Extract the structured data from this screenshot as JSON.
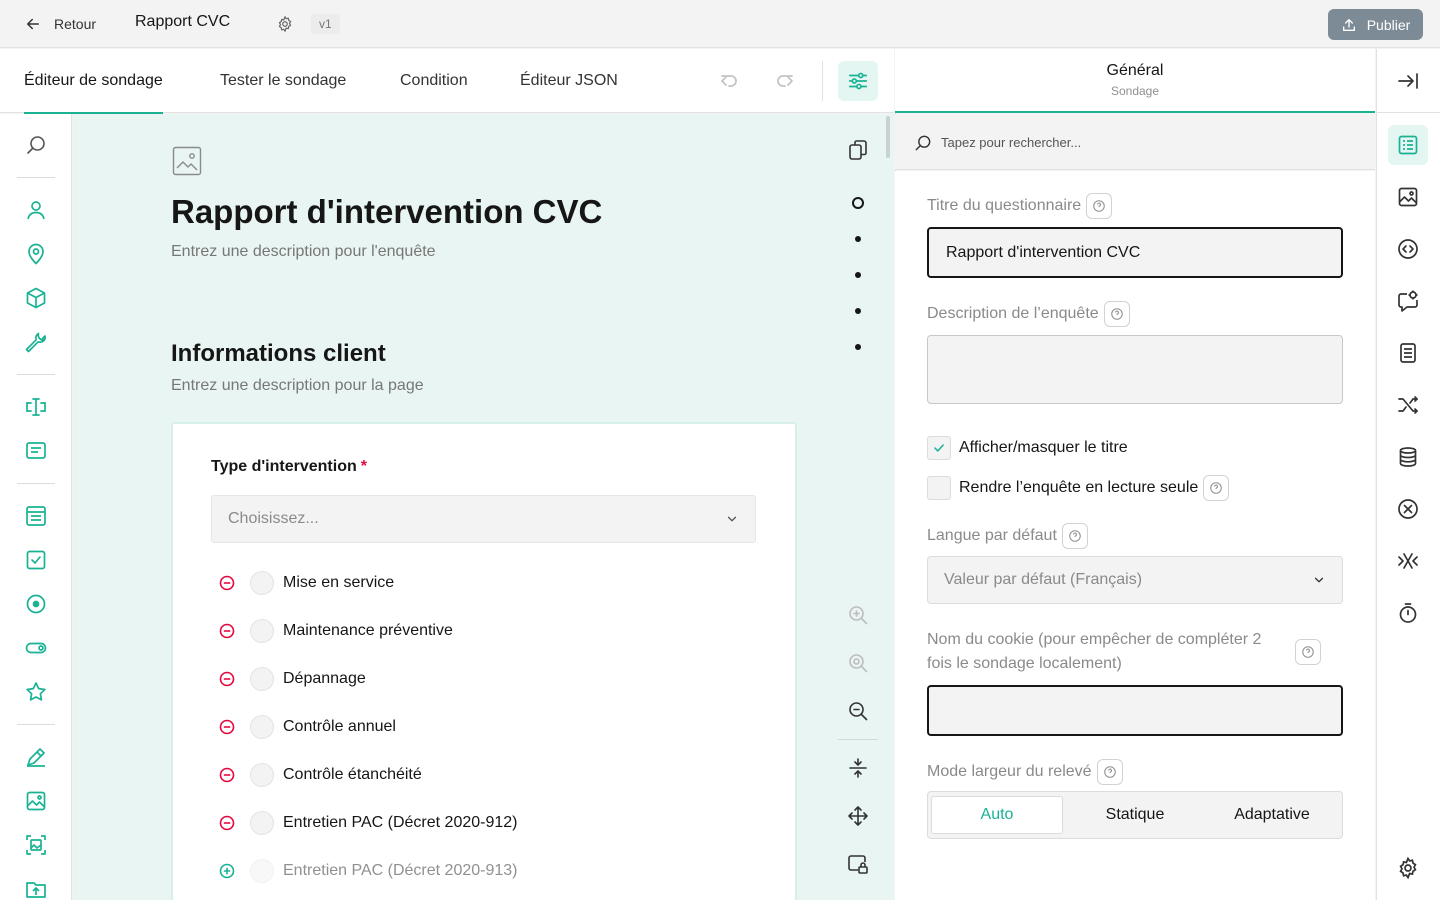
{
  "header": {
    "back_label": "Retour",
    "doc_title": "Rapport CVC",
    "version": "v1",
    "publish_label": "Publier"
  },
  "tabs": [
    {
      "label": "Éditeur de sondage",
      "active": true
    },
    {
      "label": "Tester le sondage",
      "active": false
    },
    {
      "label": "Condition",
      "active": false
    },
    {
      "label": "Éditeur JSON",
      "active": false
    }
  ],
  "survey": {
    "title": "Rapport d'intervention CVC",
    "description_placeholder": "Entrez une description pour l'enquête",
    "page": {
      "title": "Informations client",
      "description_placeholder": "Entrez une description pour la page"
    },
    "question": {
      "title": "Type d'intervention",
      "required_marker": "*",
      "select_placeholder": "Choisissez...",
      "choices": [
        "Mise en service",
        "Maintenance préventive",
        "Dépannage",
        "Contrôle annuel",
        "Contrôle étanchéité",
        "Entretien PAC (Décret 2020-912)"
      ],
      "new_choice": "Entretien PAC (Décret 2020-913)"
    }
  },
  "property_grid": {
    "title": "Général",
    "subtitle": "Sondage",
    "search_placeholder": "Tapez pour rechercher...",
    "survey_title_label": "Titre du questionnaire",
    "survey_title_value": "Rapport d'intervention CVC",
    "description_label": "Description de l’enquête",
    "show_title_label": "Afficher/masquer le titre",
    "show_title_checked": true,
    "readonly_label": "Rendre l’enquête en lecture seule",
    "readonly_checked": false,
    "language_label": "Langue par défaut",
    "language_value": "Valeur par défaut (Français)",
    "cookie_label": "Nom du cookie (pour empêcher de compléter 2 fois le sondage localement)",
    "width_mode_label": "Mode largeur du relevé",
    "width_modes": [
      "Auto",
      "Statique",
      "Adaptative"
    ],
    "width_mode_selected": "Auto"
  },
  "colors": {
    "accent": "#19b394",
    "accent_light": "#e4f6f2",
    "canvas_bg": "#e8f5f2",
    "remove_red": "#e50a3e",
    "publish_bg": "#7d8b96"
  },
  "icons": {
    "toolbox": [
      "search-icon",
      "user-icon",
      "map-pin-icon",
      "cube-icon",
      "wrench-icon",
      "text-cursor-icon",
      "comment-icon",
      "dropdown-list-icon",
      "checkbox-icon",
      "radio-icon",
      "toggle-icon",
      "star-icon",
      "signature-icon",
      "image-icon",
      "image-picker-icon",
      "file-upload-icon"
    ],
    "right_rail": [
      "collapse-right-icon",
      "general-icon",
      "logo-image-icon",
      "navigation-icon",
      "question-settings-icon",
      "pages-icon",
      "logic-icon",
      "data-icon",
      "validation-icon",
      "quiz-icon",
      "timer-icon",
      "settings-icon"
    ]
  }
}
